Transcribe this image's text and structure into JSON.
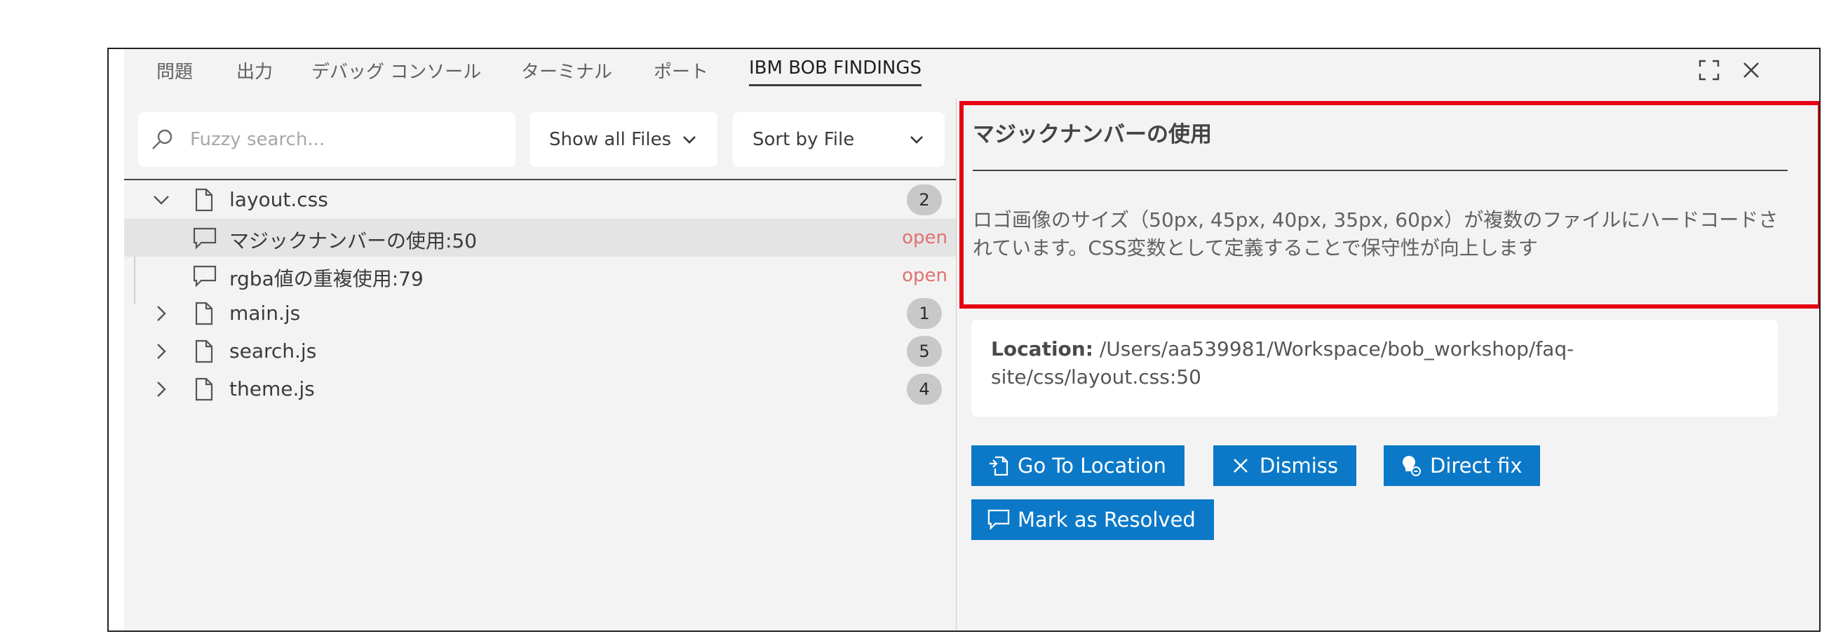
{
  "tabs": [
    {
      "label": "問題"
    },
    {
      "label": "出力"
    },
    {
      "label": "デバッグ コンソール"
    },
    {
      "label": "ターミナル"
    },
    {
      "label": "ポート"
    },
    {
      "label": "IBM BOB FINDINGS",
      "active": true
    }
  ],
  "window_controls": {
    "maximize_icon": "maximize-icon",
    "close_icon": "close-icon"
  },
  "filters": {
    "search_placeholder": "Fuzzy search...",
    "files_filter": "Show all Files",
    "sort": "Sort by File"
  },
  "tree": {
    "files": [
      {
        "name": "layout.css",
        "count": "2",
        "expanded": true,
        "findings": [
          {
            "label": "マジックナンバーの使用:50",
            "status": "open"
          },
          {
            "label": "rgba値の重複使用:79",
            "status": "open"
          }
        ]
      },
      {
        "name": "main.js",
        "count": "1",
        "expanded": false
      },
      {
        "name": "search.js",
        "count": "5",
        "expanded": false
      },
      {
        "name": "theme.js",
        "count": "4",
        "expanded": false
      }
    ]
  },
  "detail": {
    "title": "マジックナンバーの使用",
    "description": "ロゴ画像のサイズ（50px, 45px, 40px, 35px, 60px）が複数のファイルにハードコードされています。CSS変数として定義することで保守性が向上します",
    "location_label": "Location:",
    "location_value": " /Users/aa539981/Workspace/bob_workshop/faq-site/css/layout.css:50"
  },
  "actions": {
    "go_to_location": "Go To Location",
    "dismiss": "Dismiss",
    "direct_fix": "Direct fix",
    "mark_resolved": "Mark as Resolved"
  },
  "colors": {
    "accent_button": "#0c79c8",
    "status_open": "#e0726e",
    "highlight": "#e60012"
  }
}
